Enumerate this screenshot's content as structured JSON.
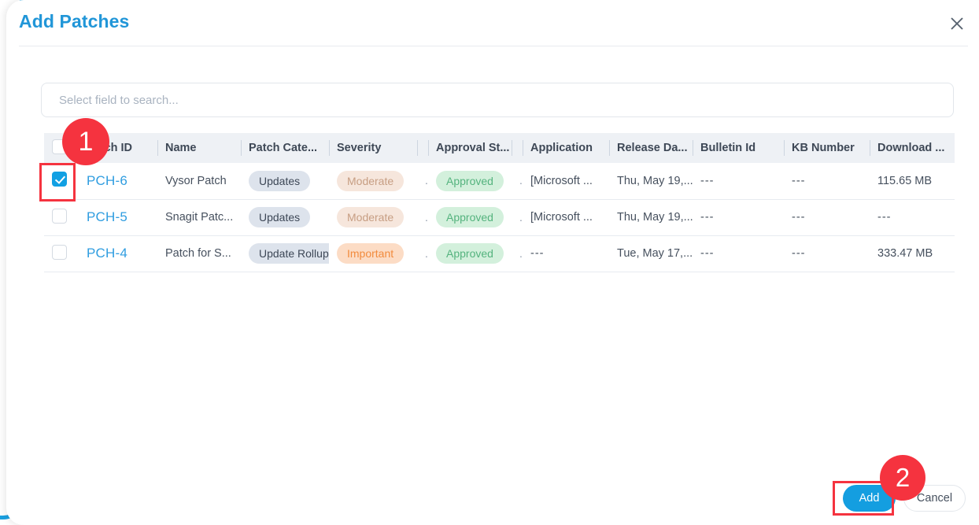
{
  "modal": {
    "title": "Add Patches",
    "close_icon": "close-icon"
  },
  "search": {
    "placeholder": "Select field to search...",
    "value": ""
  },
  "table": {
    "columns": [
      {
        "key": "check",
        "label": ""
      },
      {
        "key": "patch_id",
        "label": "Patch ID"
      },
      {
        "key": "name",
        "label": "Name"
      },
      {
        "key": "patch_category",
        "label": "Patch Cate..."
      },
      {
        "key": "severity",
        "label": "Severity"
      },
      {
        "key": "sev_more",
        "label": ""
      },
      {
        "key": "approval_status",
        "label": "Approval St..."
      },
      {
        "key": "appr_more",
        "label": ""
      },
      {
        "key": "application",
        "label": "Application"
      },
      {
        "key": "release_date",
        "label": "Release Da..."
      },
      {
        "key": "bulletin_id",
        "label": "Bulletin Id"
      },
      {
        "key": "kb_number",
        "label": "KB Number"
      },
      {
        "key": "download_size",
        "label": "Download ..."
      }
    ],
    "rows": [
      {
        "checked": true,
        "patch_id": "PCH-6",
        "name": "Vysor Patch",
        "patch_category": "Updates",
        "severity": "Moderate",
        "sev_more": "..",
        "approval_status": "Approved",
        "appr_more": "..",
        "application": "[Microsoft ...",
        "release_date": "Thu, May 19,...",
        "bulletin_id": "---",
        "kb_number": "---",
        "download_size": "115.65 MB"
      },
      {
        "checked": false,
        "patch_id": "PCH-5",
        "name": "Snagit Patc...",
        "patch_category": "Updates",
        "severity": "Moderate",
        "sev_more": "..",
        "approval_status": "Approved",
        "appr_more": "..",
        "application": "[Microsoft ...",
        "release_date": "Thu, May 19,...",
        "bulletin_id": "---",
        "kb_number": "---",
        "download_size": "---"
      },
      {
        "checked": false,
        "patch_id": "PCH-4",
        "name": "Patch for S...",
        "patch_category": "Update Rollup",
        "severity": "Important",
        "sev_more": ".",
        "approval_status": "Approved",
        "appr_more": "..",
        "application": "---",
        "release_date": "Tue, May 17,...",
        "bulletin_id": "---",
        "kb_number": "---",
        "download_size": "333.47 MB"
      }
    ]
  },
  "footer": {
    "add_label": "Add",
    "cancel_label": "Cancel"
  },
  "annotations": [
    {
      "id": "step-1",
      "label": "1"
    },
    {
      "id": "step-2",
      "label": "2"
    }
  ],
  "colors": {
    "accent": "#149ee0",
    "title": "#2196d8",
    "link": "#2f9de0",
    "annotation": "#f5333f",
    "badge_category_bg": "#dde3ec",
    "badge_moderate_bg": "#f6e6dc",
    "badge_important_bg": "#fcdcc5",
    "badge_approved_bg": "#d3f0dc"
  }
}
